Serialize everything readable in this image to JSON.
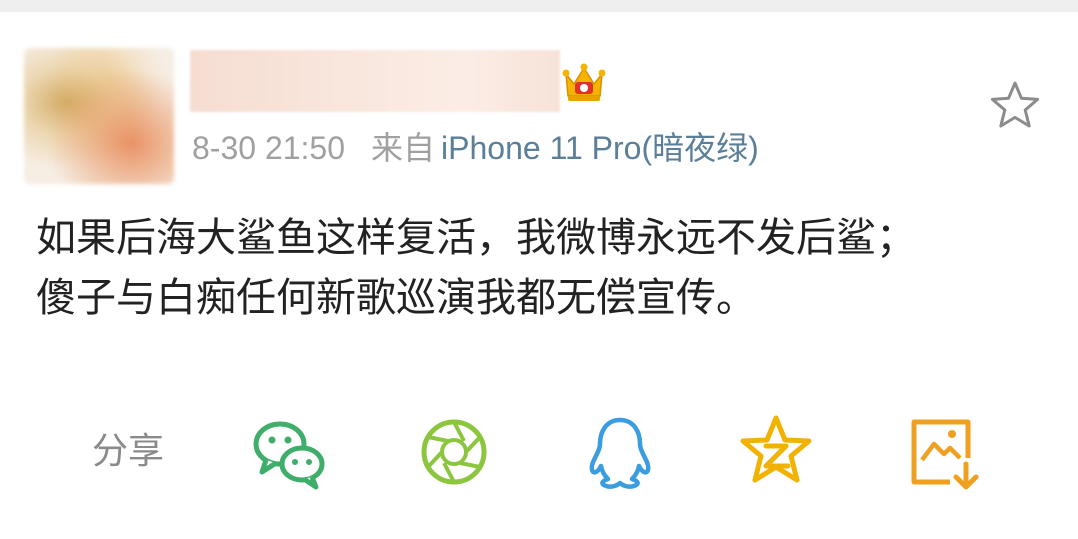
{
  "post": {
    "meta": {
      "time": "8-30 21:50",
      "from_label": "来自",
      "device": "iPhone 11 Pro(暗夜绿)"
    },
    "content_lines": [
      "如果后海大鲨鱼这样复活，我微博永远不发后鲨；",
      "傻子与白痴任何新歌巡演我都无偿宣传。"
    ]
  },
  "share": {
    "label": "分享",
    "targets": [
      {
        "icon": "wechat-icon",
        "color": "#3fae6a"
      },
      {
        "icon": "wechat-moments-icon",
        "color": "#8cc63f"
      },
      {
        "icon": "qq-icon",
        "color": "#3a9de0"
      },
      {
        "icon": "qzone-icon",
        "color": "#f2b200"
      },
      {
        "icon": "save-image-icon",
        "color": "#f0a020"
      }
    ]
  },
  "colors": {
    "device_link": "#5b7f98",
    "meta_gray": "#a0a0a0",
    "body_text": "#222222"
  }
}
